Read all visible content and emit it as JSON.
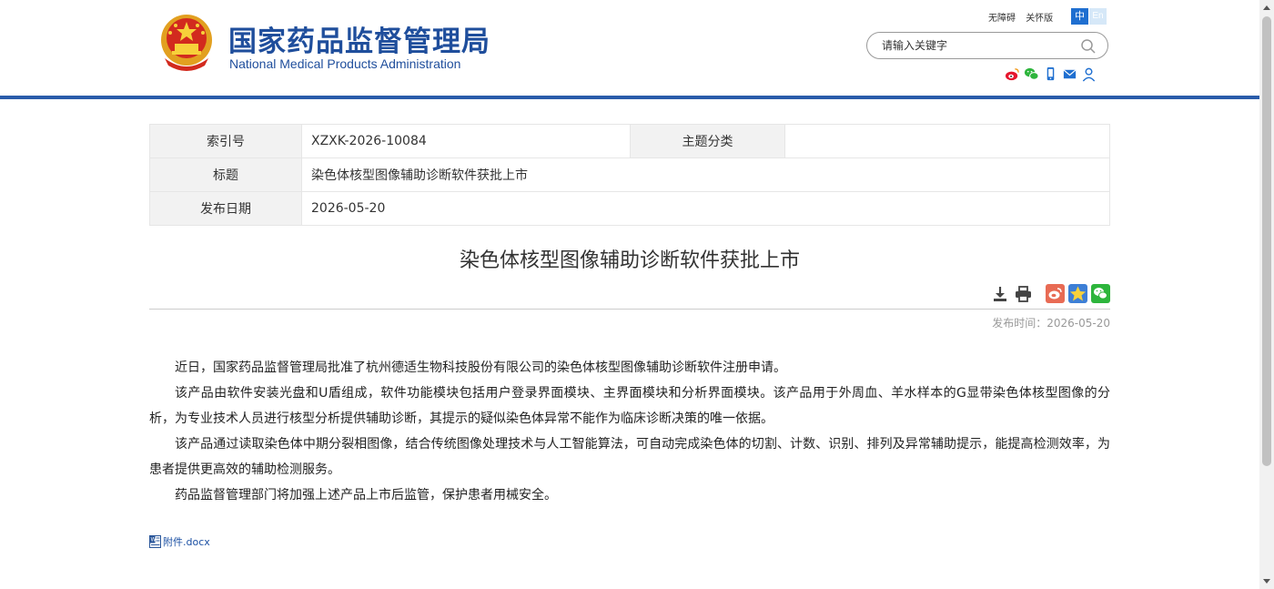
{
  "header": {
    "logo_cn": "国家药品监督管理局",
    "logo_en": "National Medical Products Administration",
    "accessibility_label": "无障碍",
    "care_mode_label": "关怀版",
    "lang_zh": "中",
    "lang_en": "En",
    "search_placeholder": "请输入关键字",
    "social_icons": [
      "weibo-icon",
      "wechat-icon",
      "mobile-icon",
      "mail-icon",
      "user-icon"
    ]
  },
  "meta_table": {
    "index_label": "索引号",
    "index_value": "XZXK-2026-10084",
    "topic_label": "主题分类",
    "topic_value": "",
    "title_label": "标题",
    "title_value": "染色体核型图像辅助诊断软件获批上市",
    "date_label": "发布日期",
    "date_value": "2026-05-20"
  },
  "article": {
    "title": "染色体核型图像辅助诊断软件获批上市",
    "pub_time": "发布时间：2026-05-20",
    "paragraphs": [
      "近日，国家药品监督管理局批准了杭州德适生物科技股份有限公司的染色体核型图像辅助诊断软件注册申请。",
      "该产品由软件安装光盘和U盾组成，软件功能模块包括用户登录界面模块、主界面模块和分析界面模块。该产品用于外周血、羊水样本的G显带染色体核型图像的分析，为专业技术人员进行核型分析提供辅助诊断，其提示的疑似染色体异常不能作为临床诊断决策的唯一依据。",
      "该产品通过读取染色体中期分裂相图像，结合传统图像处理技术与人工智能算法，可自动完成染色体的切割、计数、识别、排列及异常辅助提示，能提高检测效率，为患者提供更高效的辅助检测服务。",
      "药品监督管理部门将加强上述产品上市后监管，保护患者用械安全。"
    ],
    "attachment": "附件.docx"
  },
  "colors": {
    "brand_blue": "#1f4e9c",
    "bar_blue": "#2a5caa",
    "weibo": "#e86b54",
    "qzone": "#3d7fd6",
    "wechat": "#2db53c"
  }
}
